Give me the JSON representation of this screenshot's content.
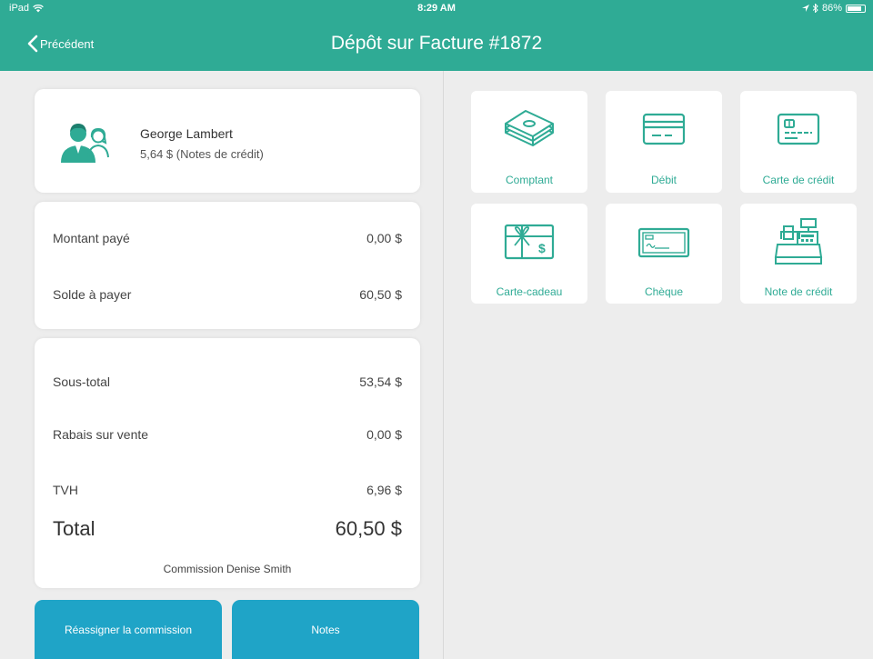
{
  "status_bar": {
    "device": "iPad",
    "time": "8:29 AM",
    "battery_text": "86%",
    "battery_level": 0.86
  },
  "nav": {
    "back_label": "Précédent",
    "title": "Dépôt sur Facture #1872"
  },
  "customer": {
    "name": "George Lambert",
    "credit": "5,64 $  (Notes de crédit)"
  },
  "balance": {
    "paid_label": "Montant payé",
    "paid_value": "0,00 $",
    "due_label": "Solde à payer",
    "due_value": "60,50 $"
  },
  "totals": {
    "subtotal_label": "Sous-total",
    "subtotal_value": "53,54 $",
    "discount_label": "Rabais sur vente",
    "discount_value": "0,00 $",
    "tax_label": "TVH",
    "tax_value": "6,96 $",
    "total_label": "Total",
    "total_value": "60,50 $",
    "commission": "Commission Denise Smith"
  },
  "buttons": {
    "reassign": "Réassigner la commission",
    "notes": "Notes"
  },
  "payment_methods": [
    {
      "label": "Comptant",
      "icon": "cash-icon"
    },
    {
      "label": "Débit",
      "icon": "debit-card-icon"
    },
    {
      "label": "Carte de crédit",
      "icon": "credit-card-icon"
    },
    {
      "label": "Carte-cadeau",
      "icon": "gift-card-icon"
    },
    {
      "label": "Chèque",
      "icon": "cheque-icon"
    },
    {
      "label": "Note de crédit",
      "icon": "cash-register-icon"
    }
  ],
  "colors": {
    "accent": "#2fab95",
    "button": "#1fa4c7",
    "background": "#ededed"
  }
}
